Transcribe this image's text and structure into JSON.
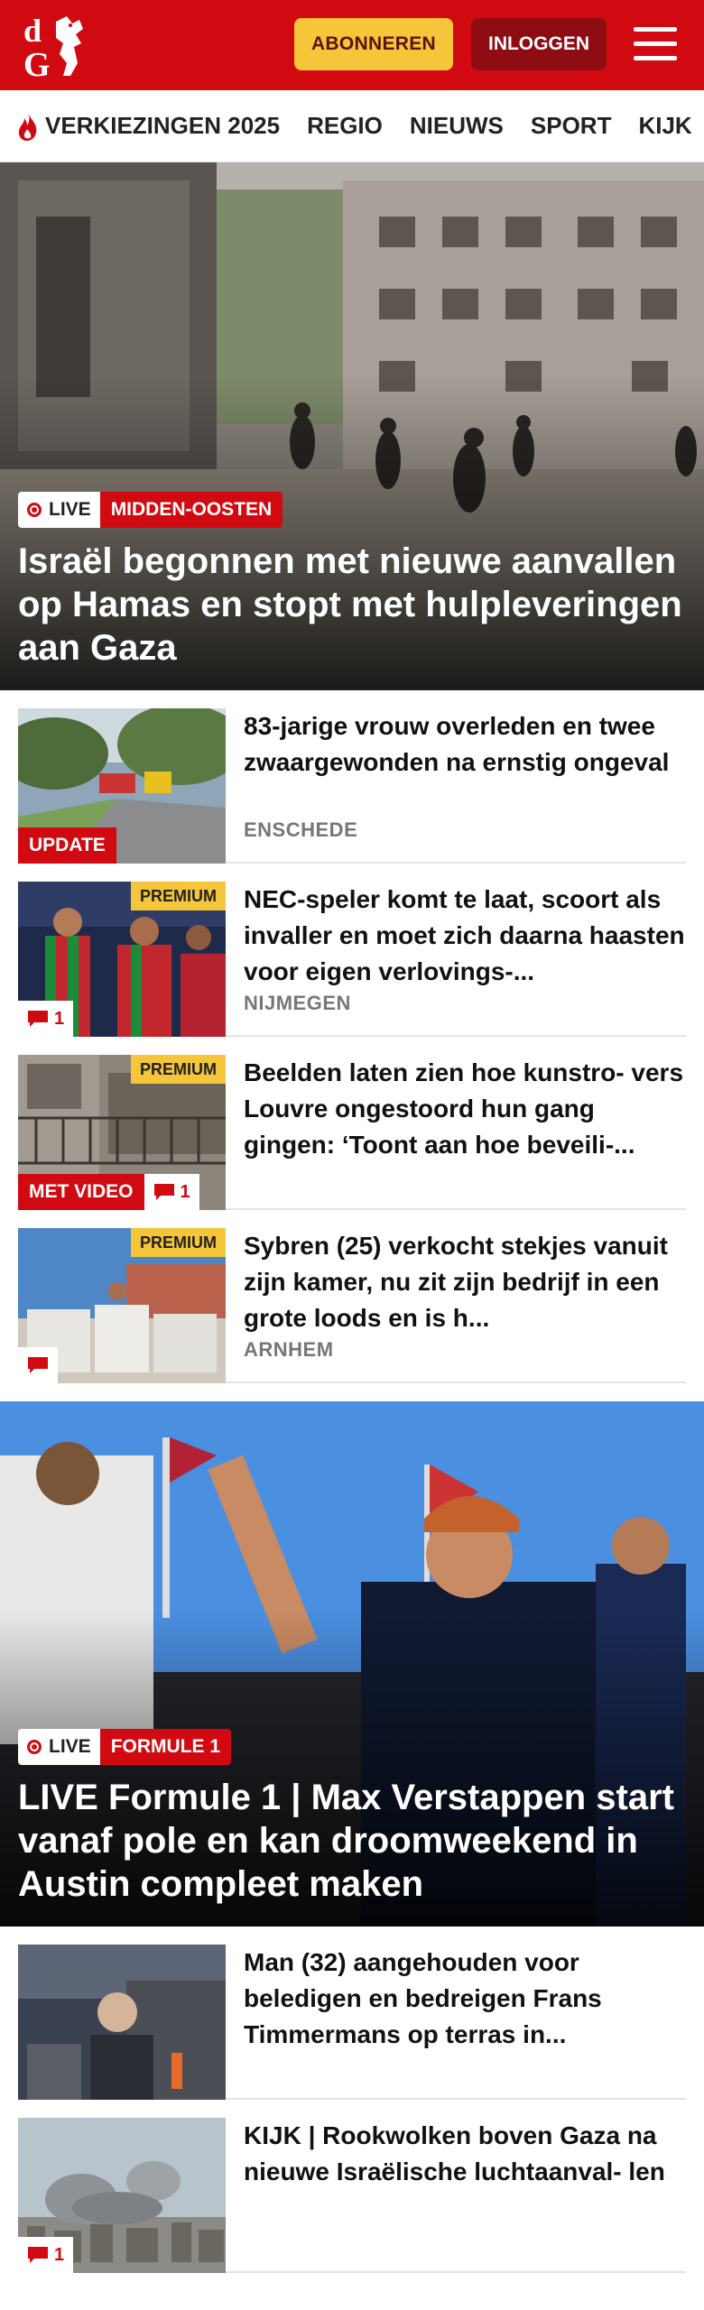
{
  "header": {
    "logo_text": "dG",
    "subscribe_label": "ABONNEREN",
    "login_label": "INLOGGEN",
    "menu_icon": "hamburger-icon"
  },
  "colors": {
    "brand_red": "#d10a11",
    "accent_yellow": "#f5c53a",
    "dark_red": "#8d0d12"
  },
  "nav": {
    "items": [
      {
        "label": "VERKIEZINGEN 2025",
        "icon": "flame-icon"
      },
      {
        "label": "REGIO"
      },
      {
        "label": "NIEUWS"
      },
      {
        "label": "SPORT"
      },
      {
        "label": "KIJK"
      }
    ]
  },
  "hero1": {
    "live_label": "LIVE",
    "category": "MIDDEN-OOSTEN",
    "title": "Israël begonnen met nieuwe aanvallen op Hamas en stopt met hulpleveringen aan Gaza"
  },
  "articles": [
    {
      "title": "83-jarige vrouw overleden en twee zwaargewonden na ernstig ongeval",
      "location": "ENSCHEDE",
      "tag": "UPDATE"
    },
    {
      "title": "NEC-speler komt te laat, scoort als invaller en moet zich daarna haasten voor eigen verlovings-...",
      "location": "NIJMEGEN",
      "premium": "PREMIUM",
      "comments": "1"
    },
    {
      "title": "Beelden laten zien hoe kunstro- vers Louvre ongestoord hun gang gingen: ‘Toont aan hoe beveili-...",
      "premium": "PREMIUM",
      "video": "MET VIDEO",
      "comments": "1"
    },
    {
      "title": "Sybren (25) verkocht stekjes vanuit zijn kamer, nu zit zijn bedrijf in een grote loods en is h...",
      "location": "ARNHEM",
      "premium": "PREMIUM"
    }
  ],
  "hero2": {
    "live_label": "LIVE",
    "category": "FORMULE 1",
    "title": "LIVE Formule 1 | Max Verstappen start vanaf pole en kan droomweekend in Austin compleet maken"
  },
  "articles2": [
    {
      "title": "Man (32) aangehouden voor beledigen en bedreigen Frans Timmermans op terras in..."
    },
    {
      "title": "KIJK | Rookwolken boven Gaza na nieuwe Israëlische luchtaanval- len",
      "comments": "1"
    }
  ]
}
